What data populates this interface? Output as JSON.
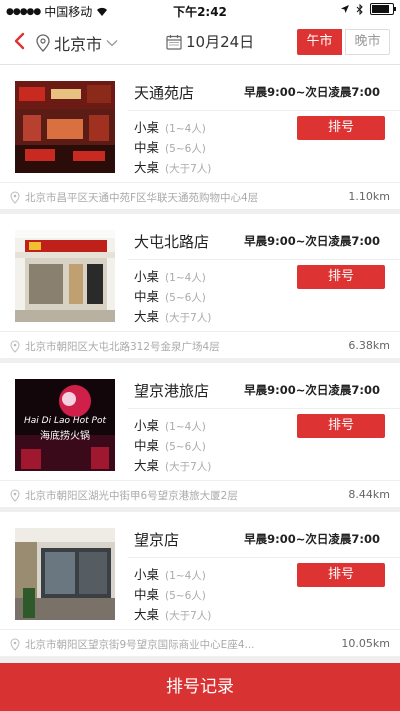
{
  "status": {
    "carrier": "中国移动",
    "time": "下午2:42"
  },
  "nav": {
    "city": "北京市",
    "date": "10月24日",
    "market_active": "午市",
    "market_inactive": "晚市"
  },
  "stores": [
    {
      "name": "天通苑店",
      "hours": "早晨9:00~次日凌晨7:00",
      "small": "小桌",
      "small_cap": "(1~4人)",
      "medium": "中桌",
      "medium_cap": "(5~6人)",
      "large": "大桌",
      "large_cap": "(大于7人)",
      "button": "排号",
      "address": "北京市昌平区天通中苑F区华联天通苑购物中心4层",
      "distance": "1.10km"
    },
    {
      "name": "大屯北路店",
      "hours": "早晨9:00~次日凌晨7:00",
      "small": "小桌",
      "small_cap": "(1~4人)",
      "medium": "中桌",
      "medium_cap": "(5~6人)",
      "large": "大桌",
      "large_cap": "(大于7人)",
      "button": "排号",
      "address": "北京市朝阳区大屯北路312号金泉广场4层",
      "distance": "6.38km"
    },
    {
      "name": "望京港旅店",
      "hours": "早晨9:00~次日凌晨7:00",
      "small": "小桌",
      "small_cap": "(1~4人)",
      "medium": "中桌",
      "medium_cap": "(5~6人)",
      "large": "大桌",
      "large_cap": "(大于7人)",
      "button": "排号",
      "address": "北京市朝阳区湖光中街甲6号望京港旅大厦2层",
      "distance": "8.44km"
    },
    {
      "name": "望京店",
      "hours": "早晨9:00~次日凌晨7:00",
      "small": "小桌",
      "small_cap": "(1~4人)",
      "medium": "中桌",
      "medium_cap": "(5~6人)",
      "large": "大桌",
      "large_cap": "(大于7人)",
      "button": "排号",
      "address": "北京市朝阳区望京街9号望京国际商业中心E座4...",
      "distance": "10.05km"
    }
  ],
  "store_image_texts": [
    "海底捞火锅",
    "Hai Di Lao Hot Pot"
  ],
  "bottom": {
    "label": "排号记录"
  },
  "colors": {
    "accent": "#dd3333",
    "bottom_bar": "#d93232"
  }
}
